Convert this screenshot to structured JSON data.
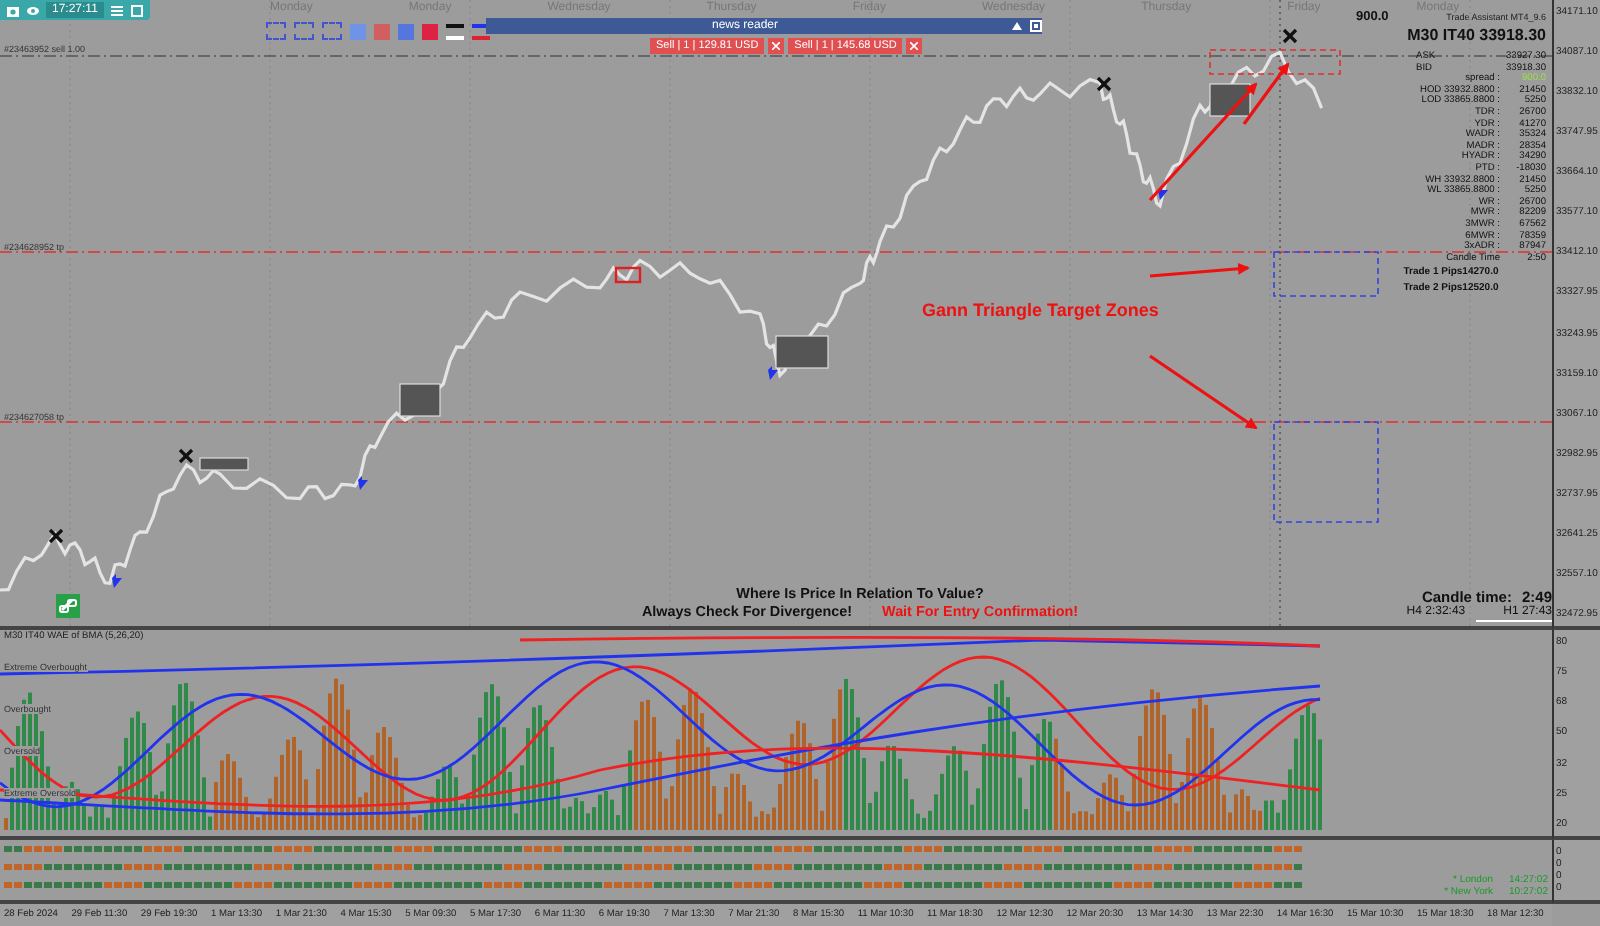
{
  "toolbar": {
    "time": "17:27:11"
  },
  "day_labels": [
    "Monday",
    "Monday",
    "Wednesday",
    "Thursday",
    "Friday",
    "Wednesday",
    "Thursday",
    "Friday",
    "Monday"
  ],
  "swatches": [
    {
      "color": "#6f93e6"
    },
    {
      "color": "#d06060"
    },
    {
      "color": "#5577dd"
    },
    {
      "color": "#dd2244"
    }
  ],
  "news_reader": {
    "title": "news reader"
  },
  "orders": [
    {
      "label": "Sell | 1 | 129.81 USD"
    },
    {
      "label": "Sell | 1 | 145.68 USD"
    }
  ],
  "order_lines": [
    {
      "label": "#23463952 sell 1.00"
    },
    {
      "label": "#234628952 tp"
    },
    {
      "label": "#234627058 tp"
    }
  ],
  "info_panel": {
    "value": "900.0",
    "title": "Trade Assistant MT4_9.6",
    "symbol": "M30 IT40 33918.30",
    "quotes": [
      {
        "label": "ASK",
        "value": "33927.30"
      },
      {
        "label": "BID",
        "value": "33918.30"
      }
    ],
    "rows": [
      {
        "label": "spread :",
        "value": "900.0",
        "kind": "accent"
      },
      {
        "label": "HOD 33932.8800 :",
        "value": "21450",
        "kind": "plain"
      },
      {
        "label": "LOD 33865.8800 :",
        "value": "5250",
        "kind": "plain"
      },
      {
        "label": "TDR :",
        "value": "26700",
        "kind": "plain"
      },
      {
        "label": "YDR :",
        "value": "41270",
        "kind": "plain"
      },
      {
        "label": "WADR :",
        "value": "35324",
        "kind": "plain"
      },
      {
        "label": "MADR :",
        "value": "28354",
        "kind": "plain"
      },
      {
        "label": "HYADR :",
        "value": "34290",
        "kind": "plain"
      },
      {
        "label": "PTD :",
        "value": "-18030",
        "kind": "plain"
      },
      {
        "label": "WH 33932.8800 :",
        "value": "21450",
        "kind": "plain"
      },
      {
        "label": "WL 33865.8800 :",
        "value": "5250",
        "kind": "plain"
      },
      {
        "label": "WR :",
        "value": "26700",
        "kind": "plain"
      },
      {
        "label": "MWR :",
        "value": "82209",
        "kind": "plain"
      },
      {
        "label": "3MWR :",
        "value": "67562",
        "kind": "plain"
      },
      {
        "label": "6MWR :",
        "value": "78359",
        "kind": "plain"
      },
      {
        "label": "3xADR :",
        "value": "87947",
        "kind": "plain"
      },
      {
        "label": "Candle Time",
        "value": "2:50",
        "kind": "plain"
      }
    ],
    "trades": [
      "Trade 1 Pips14270.0",
      "Trade 2 Pips12520.0"
    ]
  },
  "gann_label": "Gann Triangle Target Zones",
  "messages": [
    {
      "text": "Where Is Price In Relation To Value?",
      "kind": "note"
    },
    {
      "text": "Always Check For Divergence!",
      "kind": "note"
    },
    {
      "text": "Wait For Entry Confirmation!",
      "kind": "warning"
    }
  ],
  "candle_timer": {
    "label": "Candle time:",
    "value": "2:49",
    "h4": "H4 2:32:43",
    "h1": "H1 27:43"
  },
  "indicator": {
    "title": "M30 IT40 WAE of BMA (5,26,20)",
    "levels": [
      "Extreme Overbought",
      "Overbought",
      "Oversold",
      "Extreme Oversold"
    ]
  },
  "sessions": [
    {
      "name": "* London",
      "time": "14:27:02"
    },
    {
      "name": "* New York",
      "time": "10:27:02"
    }
  ],
  "price_axis": [
    "34171.10",
    "34087.10",
    "33832.10",
    "33747.95",
    "33664.10",
    "33577.10",
    "33412.10",
    "33327.95",
    "33243.95",
    "33159.10",
    "33067.10",
    "32982.95",
    "32737.95",
    "32641.25",
    "32557.10",
    "32472.95"
  ],
  "indicator_axis": [
    "80",
    "75",
    "68",
    "50",
    "32",
    "25",
    "20"
  ],
  "sub_axis": [
    "0",
    "0",
    "0",
    "0"
  ],
  "time_axis": [
    "28 Feb 2024",
    "29 Feb 11:30",
    "29 Feb 19:30",
    "1 Mar 13:30",
    "1 Mar 21:30",
    "4 Mar 15:30",
    "5 Mar 09:30",
    "5 Mar 17:30",
    "6 Mar 11:30",
    "6 Mar 19:30",
    "7 Mar 13:30",
    "7 Mar 21:30",
    "8 Mar 15:30",
    "11 Mar 10:30",
    "11 Mar 18:30",
    "12 Mar 12:30",
    "12 Mar 20:30",
    "13 Mar 14:30",
    "13 Mar 22:30",
    "14 Mar 16:30",
    "15 Mar 10:30",
    "15 Mar 18:30",
    "18 Mar 12:30"
  ]
}
